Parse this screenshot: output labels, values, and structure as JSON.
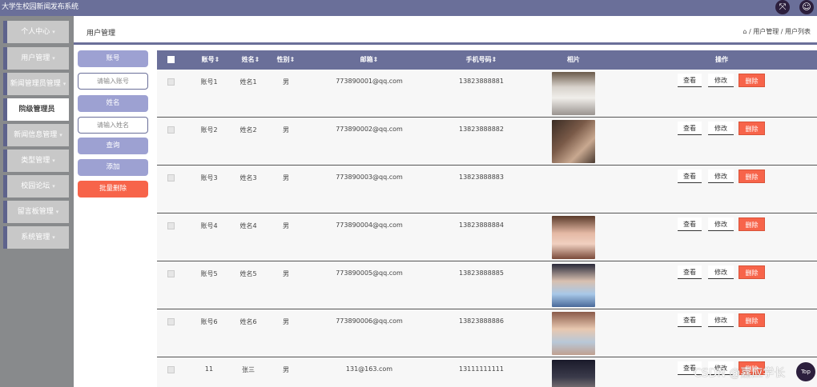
{
  "app": {
    "title": "大学生校园新闻发布系统"
  },
  "topbar": {
    "icons": [
      "expand-icon",
      "user-icon"
    ]
  },
  "sidebar": {
    "items": [
      {
        "label": "个人中心",
        "caret": "▾"
      },
      {
        "label": "用户管理",
        "caret": "▾"
      },
      {
        "label": "新闻管理员管理",
        "caret": "▾"
      },
      {
        "label": "院级管理员",
        "caret": ""
      },
      {
        "label": "新闻信息管理",
        "caret": "▾"
      },
      {
        "label": "类型管理",
        "caret": "▾"
      },
      {
        "label": "校园论坛",
        "caret": "▾"
      },
      {
        "label": "留言板管理",
        "caret": "▾"
      },
      {
        "label": "系统管理",
        "caret": "▾"
      }
    ]
  },
  "header": {
    "title": "用户管理",
    "breadcrumb": "⌂ / 用户管理 / 用户列表"
  },
  "search": {
    "account_label": "账号",
    "account_placeholder": "请输入账号",
    "name_label": "姓名",
    "name_placeholder": "请输入姓名",
    "query_btn": "查询",
    "add_btn": "添加",
    "batch_delete_btn": "批量删除"
  },
  "table": {
    "headers": [
      "账号",
      "姓名",
      "性别",
      "邮箱",
      "手机号码",
      "相片",
      "操作"
    ],
    "actions": {
      "view": "查看",
      "edit": "修改",
      "delete": "删除"
    },
    "rows": [
      {
        "account": "账号1",
        "name": "姓名1",
        "gender": "男",
        "email": "773890001@qq.com",
        "phone": "13823888881",
        "photo": "photo-1"
      },
      {
        "account": "账号2",
        "name": "姓名2",
        "gender": "男",
        "email": "773890002@qq.com",
        "phone": "13823888882",
        "photo": "photo-2"
      },
      {
        "account": "账号3",
        "name": "姓名3",
        "gender": "男",
        "email": "773890003@qq.com",
        "phone": "13823888883",
        "photo": ""
      },
      {
        "account": "账号4",
        "name": "姓名4",
        "gender": "男",
        "email": "773890004@qq.com",
        "phone": "13823888884",
        "photo": "photo-4"
      },
      {
        "account": "账号5",
        "name": "姓名5",
        "gender": "男",
        "email": "773890005@qq.com",
        "phone": "13823888885",
        "photo": "photo-5"
      },
      {
        "account": "账号6",
        "name": "姓名6",
        "gender": "男",
        "email": "773890006@qq.com",
        "phone": "13823888886",
        "photo": "photo-6"
      },
      {
        "account": "11",
        "name": "张三",
        "gender": "男",
        "email": "131@163.com",
        "phone": "13111111111",
        "photo": "photo-7"
      }
    ]
  },
  "watermark": "CSDN @嘉应学长",
  "top_button": "Top",
  "colors": {
    "primary": "#6a6f99",
    "accent": "#9da1d2",
    "danger": "#f7644a",
    "sidebar_bg": "#888a8c"
  }
}
